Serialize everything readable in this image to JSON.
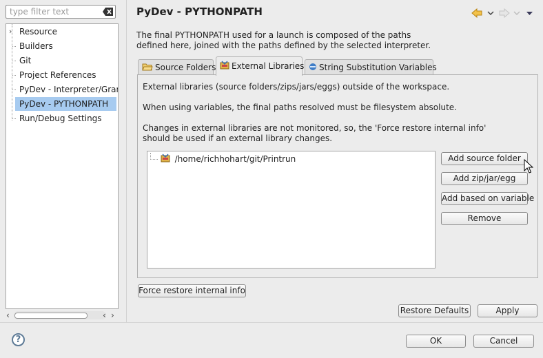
{
  "filter": {
    "placeholder": "type filter text",
    "clear_icon": "clear-icon"
  },
  "tree": {
    "items": [
      {
        "label": "Resource",
        "expandable": true
      },
      {
        "label": "Builders"
      },
      {
        "label": "Git"
      },
      {
        "label": "Project References"
      },
      {
        "label": "PyDev - Interpreter/Gram"
      },
      {
        "label": "PyDev - PYTHONPATH",
        "selected": true
      },
      {
        "label": "Run/Debug Settings"
      }
    ]
  },
  "page": {
    "title": "PyDev - PYTHONPATH",
    "description": [
      "The final PYTHONPATH used for a launch is composed of the paths",
      "defined here, joined with the paths defined by the selected interpreter."
    ]
  },
  "tabs": [
    {
      "label": "Source Folders",
      "icon": "folder-icon"
    },
    {
      "label": "External Libraries",
      "icon": "library-icon",
      "active": true
    },
    {
      "label": "String Substitution Variables",
      "icon": "variable-icon"
    }
  ],
  "external": {
    "line1": "External libraries (source folders/zips/jars/eggs) outside of the workspace.",
    "line2": "When using variables, the final paths resolved must be filesystem absolute.",
    "line3": "Changes in external libraries are not monitored, so, the 'Force restore internal info'",
    "line4": "should be used if an external library changes.",
    "libraries": [
      "/home/richhohart/git/Printrun"
    ],
    "buttons": {
      "add_source_folder": "Add source folder",
      "add_zip": "Add zip/jar/egg",
      "add_variable": "Add based on variable",
      "remove": "Remove"
    }
  },
  "force_restore": "Force restore internal info",
  "restore_defaults": "Restore Defaults",
  "apply": "Apply",
  "ok": "OK",
  "cancel": "Cancel",
  "help": "?",
  "colors": {
    "selection": "#a7cbf0",
    "accent": "#2a6fd6",
    "nav_arrow": "#e6a21a"
  }
}
